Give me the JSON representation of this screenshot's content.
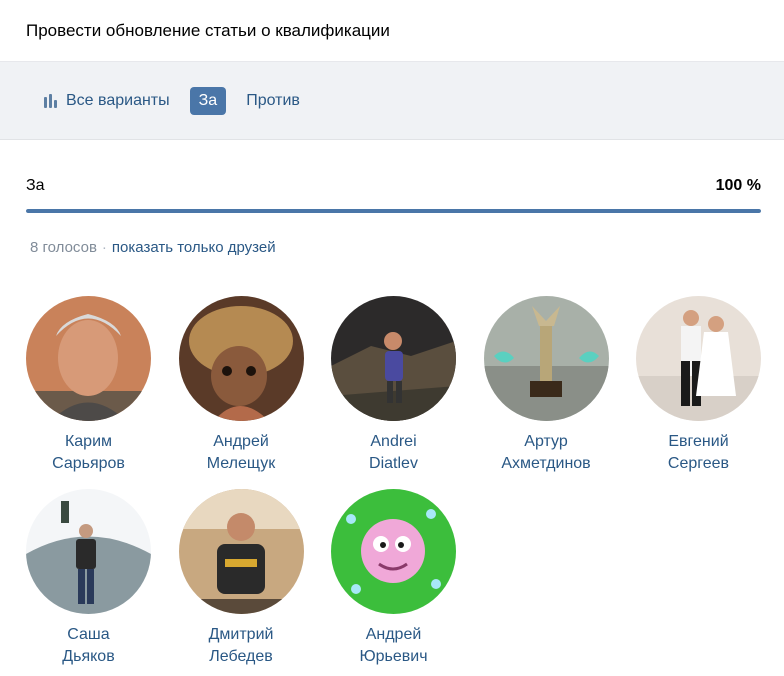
{
  "poll": {
    "title": "Провести обновление статьи о квалификации"
  },
  "tabs": [
    {
      "label": "Все варианты",
      "icon": "bar-chart-icon",
      "active": false
    },
    {
      "label": "За",
      "active": true
    },
    {
      "label": "Против",
      "active": false
    }
  ],
  "result": {
    "option": "За",
    "percent_text": "100 %",
    "percent": 100
  },
  "votes": {
    "count_text": "8 голосов",
    "separator": "·",
    "friends_link": "показать только друзей"
  },
  "voters": [
    {
      "first": "Карим",
      "last": "Сарьяров"
    },
    {
      "first": "Андрей",
      "last": "Мелещук"
    },
    {
      "first": "Andrei",
      "last": "Diatlev"
    },
    {
      "first": "Артур",
      "last": "Ахметдинов"
    },
    {
      "first": "Евгений",
      "last": "Сергеев"
    },
    {
      "first": "Саша",
      "last": "Дьяков"
    },
    {
      "first": "Дмитрий",
      "last": "Лебедев"
    },
    {
      "first": "Андрей",
      "last": "Юрьевич"
    }
  ],
  "colors": {
    "accent": "#4a76a8",
    "link": "#2a5885",
    "muted": "#818c99",
    "tabs_bg": "#f0f2f5"
  }
}
